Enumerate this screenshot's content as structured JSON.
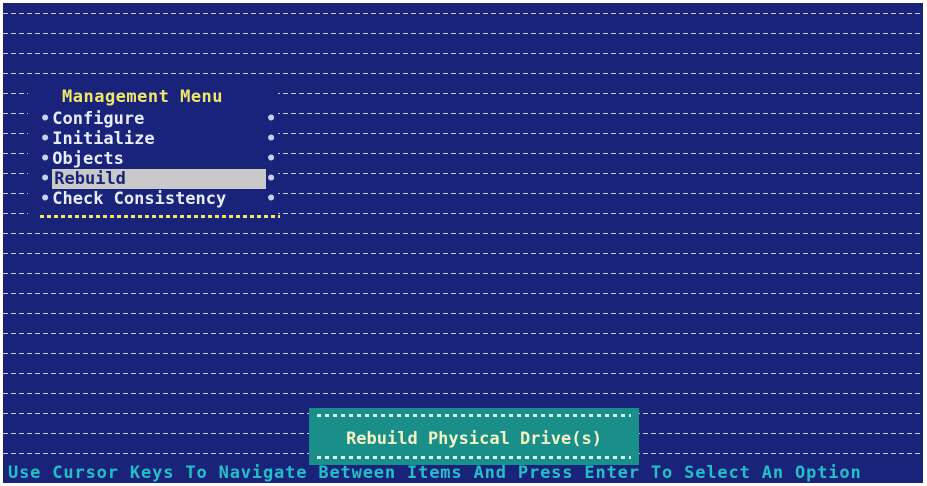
{
  "menu": {
    "title": "Management Menu",
    "items": [
      {
        "label": "Configure",
        "selected": false
      },
      {
        "label": "Initialize",
        "selected": false
      },
      {
        "label": "Objects",
        "selected": false
      },
      {
        "label": "Rebuild",
        "selected": true
      },
      {
        "label": "Check Consistency",
        "selected": false
      }
    ]
  },
  "dialog": {
    "text": "Rebuild Physical Drive(s)"
  },
  "status_bar": {
    "text": "Use Cursor Keys To Navigate Between Items And Press Enter To Select An Option"
  },
  "colors": {
    "background": "#1a237a",
    "dots": "#c9cfee",
    "title": "#f1e86a",
    "selection": "#c9c9c9",
    "dialog": "#1a8f8a",
    "status_text": "#22c0c6"
  }
}
